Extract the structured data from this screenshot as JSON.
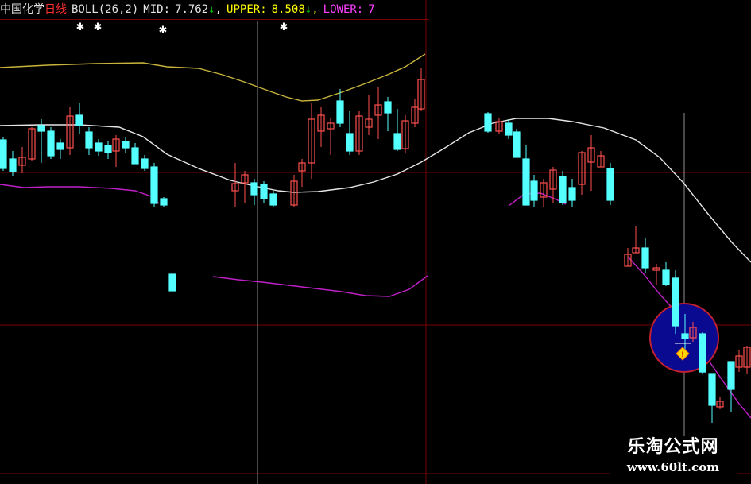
{
  "header": {
    "stock_name": "中国化学",
    "period": "日线",
    "indicator": "BOLL(26,2)",
    "mid_label": "MID:",
    "mid_value": "7.762",
    "mid_arrow": "↓",
    "upper_label": "UPPER:",
    "upper_value": "8.508",
    "upper_arrow": "↓",
    "lower_label": "LOWER:",
    "lower_value": "7",
    "sep": ","
  },
  "watermark": {
    "title": "乐淘公式网",
    "url": "www.60lt.com"
  },
  "colors": {
    "background": "#000000",
    "up_candle": "#ff4f4f",
    "down_candle": "#54ffff",
    "mid_line": "#e6e6e6",
    "upper_line": "#c8b43c",
    "lower_line": "#c020c8",
    "grid": "#7a0000",
    "crosshair": "#909090",
    "header_name": "#e0e0e0",
    "header_period": "#ff3030",
    "header_mid": "#e6e6e6",
    "header_upper": "#ffff00",
    "header_lower": "#ff40ff",
    "arrow": "#00d000",
    "circle_fill": "#0a0a90",
    "circle_stroke": "#c02030",
    "signal_diamond": "#ffd700"
  },
  "chart_data": {
    "type": "candlestick",
    "indicator": "BOLL(26,2)",
    "signal_markers_x": [
      21,
      26,
      43,
      77
    ]
  }
}
